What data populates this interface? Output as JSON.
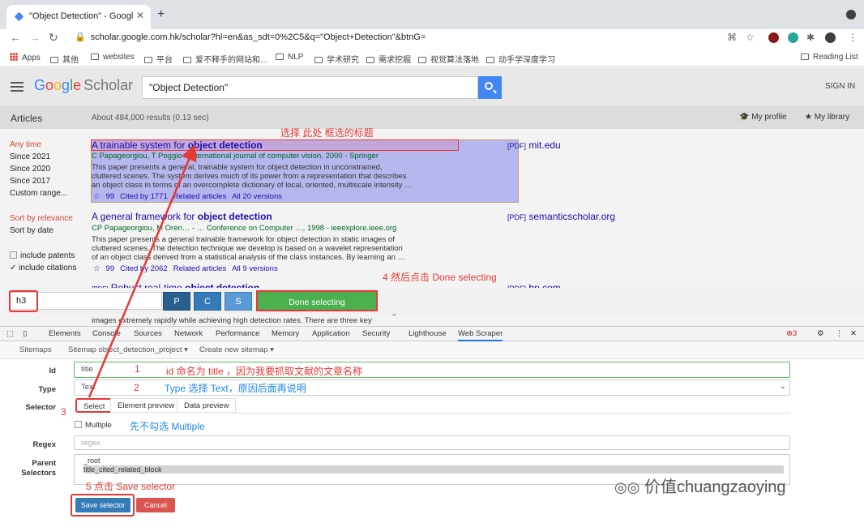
{
  "browser": {
    "tab_title": "\"Object Detection\" - Google S",
    "url": "scholar.google.com.hk/scholar?hl=en&as_sdt=0%2C5&q=\"Object+Detection\"&btnG=",
    "bookmarks": [
      "Apps",
      "其他",
      "websites",
      "平台",
      "爱不释手的网站和…",
      "NLP",
      "学术研究",
      "需求挖掘",
      "视觉算法落地",
      "动手学深度学习"
    ],
    "reading_list": "Reading List"
  },
  "scholar": {
    "logo_google": [
      "G",
      "o",
      "o",
      "g",
      "l",
      "e"
    ],
    "logo_scholar": "Scholar",
    "query": "\"Object Detection\"",
    "sign_in": "SIGN IN",
    "articles": "Articles",
    "result_count": "About 484,000 results (0.13 sec)",
    "my_profile": "My profile",
    "my_library": "My library",
    "time_filters": [
      "Any time",
      "Since 2021",
      "Since 2020",
      "Since 2017",
      "Custom range..."
    ],
    "sort": [
      "Sort by relevance",
      "Sort by date"
    ],
    "include_patents": "include patents",
    "include_citations": "include citations",
    "results": [
      {
        "title_plain": "A trainable system for ",
        "title_bold": "object detection",
        "authors": "C Papageorgiou, T Poggio - International journal of computer vision, 2000 - Springer",
        "snippet": [
          "This paper presents a general, trainable system for object detection in unconstrained,",
          "cluttered scenes. The system derives much of its power from a representation that describes",
          "an object class in terms of an overcomplete dictionary of local, oriented, multiscale intensity …"
        ],
        "links": [
          "☆",
          "99",
          "Cited by 1771",
          "Related articles",
          "All 20 versions"
        ],
        "pdf_tag": "[PDF]",
        "pdf_site": "mit.edu"
      },
      {
        "title_plain": "A general framework for ",
        "title_bold": "object detection",
        "authors": "CP Papageorgiou, M Oren… - … Conference on Computer …, 1998 - ieeexplore.ieee.org",
        "snippet": [
          "This paper presents a general trainable framework for object detection in static images of",
          "cluttered scenes. The detection technique we develop is based on a wavelet representation",
          "of an object class derived from a statistical analysis of the class instances. By learning an …"
        ],
        "links": [
          "☆",
          "99",
          "Cited by 2062",
          "Related articles",
          "All 9 versions"
        ],
        "pdf_tag": "[PDF]",
        "pdf_site": "semanticscholar.org"
      },
      {
        "title_prefix": "[PDF]",
        "title_plain": "Robust real-time ",
        "title_bold": "object detection",
        "snippet": [
          "…essing",
          "images extremely rapidly while achieving high detection rates. There are three key"
        ],
        "pdf_tag": "[PDF]",
        "pdf_site": "hp.com"
      }
    ]
  },
  "selection_bar": {
    "selector_value": "h3",
    "btn_p": "P",
    "btn_c": "C",
    "btn_s": "S",
    "done": "Done selecting"
  },
  "devtools": {
    "tabs": [
      "Elements",
      "Console",
      "Sources",
      "Network",
      "Performance",
      "Memory",
      "Application",
      "Security",
      "Lighthouse",
      "Web Scraper"
    ],
    "error_count": "3",
    "sub_tabs": [
      "Sitemaps",
      "Sitemap object_detection_project ▾",
      "Create new sitemap ▾"
    ]
  },
  "form": {
    "id_label": "Id",
    "id_value": "title",
    "type_label": "Type",
    "type_value": "Text",
    "selector_label": "Selector",
    "select_btn": "Select",
    "element_preview": "Element preview",
    "data_preview": "Data preview",
    "multiple_label": "Multiple",
    "regex_label": "Regex",
    "regex_placeholder": "regex",
    "parent_label_1": "Parent",
    "parent_label_2": "Selectors",
    "parents": [
      "_root",
      "title_cited_related_block"
    ],
    "save_btn": "Save selector",
    "cancel_btn": "Cancel"
  },
  "annotations": {
    "select_title": "选择 此处 框选的标题",
    "step4": "4  然后点击 Done selecting",
    "step1_num": "1",
    "step1": "id 命名为 title ，因为我要抓取文献的文章名称",
    "step2_num": "2",
    "step2": "Type 选择 Text，原因后面再说明",
    "step3_num": "3",
    "multiple_note": "先不勾选 Multiple",
    "step5": "5  点击 Save selector",
    "watermark": "价值chuangzaoying"
  },
  "colors": {
    "accent_red": "#e53935",
    "google_blue": "#4285f4",
    "done_green": "#4caf50",
    "save_blue": "#337ab7",
    "cancel_red": "#d9534f"
  }
}
